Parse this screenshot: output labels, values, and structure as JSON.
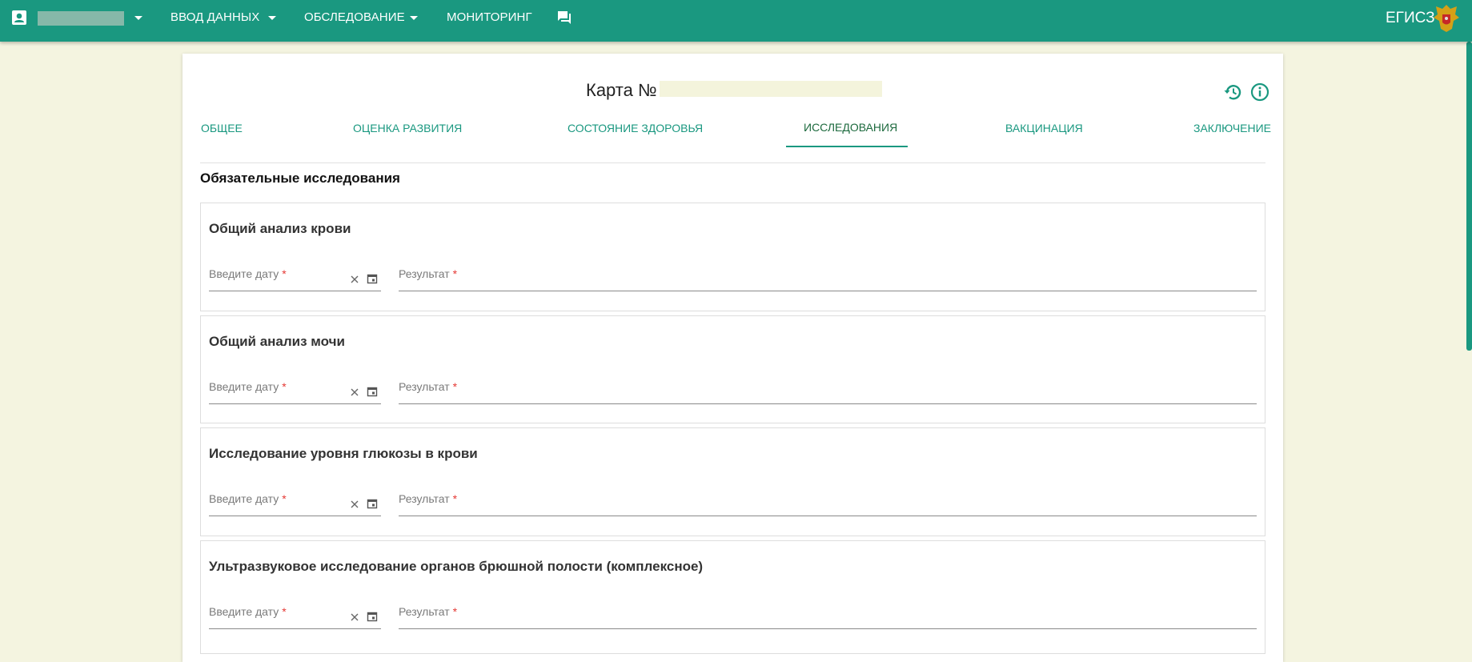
{
  "topbar": {
    "nav": [
      {
        "label": "ВВОД ДАННЫХ"
      },
      {
        "label": "ОБСЛЕДОВАНИЕ"
      },
      {
        "label": "МОНИТОРИНГ"
      }
    ],
    "brand": "ЕГИСЗ",
    "icons": {
      "user": "account-box-icon",
      "dropdown": "caret-down-icon",
      "messages": "chat-icon",
      "emblem": "coat-of-arms-icon"
    },
    "color": "#1a9880"
  },
  "card": {
    "title": "Карта №",
    "icons": {
      "history": "history-icon",
      "info": "info-icon"
    },
    "tabs": [
      {
        "label": "Общее"
      },
      {
        "label": "Оценка развития"
      },
      {
        "label": "Состояние здоровья"
      },
      {
        "label": "Исследования",
        "active": true
      },
      {
        "label": "Вакцинация"
      },
      {
        "label": "Заключение"
      }
    ],
    "section_title": "Обязательные исследования",
    "studies": [
      {
        "title": "Общий анализ крови",
        "date_label": "Введите дату",
        "result_label": "Результат",
        "required_mark": "*"
      },
      {
        "title": "Общий анализ мочи",
        "date_label": "Введите дату",
        "result_label": "Результат",
        "required_mark": "*"
      },
      {
        "title": "Исследование уровня глюкозы в крови",
        "date_label": "Введите дату",
        "result_label": "Результат",
        "required_mark": "*"
      },
      {
        "title": "Ультразвуковое исследование органов брюшной полости (комплексное)",
        "date_label": "Введите дату",
        "result_label": "Результат",
        "required_mark": "*"
      }
    ]
  },
  "colors": {
    "accent": "#1a9880",
    "active_tab": "#1d6a3e",
    "required": "#e53935",
    "background": "#f4f4e0"
  }
}
